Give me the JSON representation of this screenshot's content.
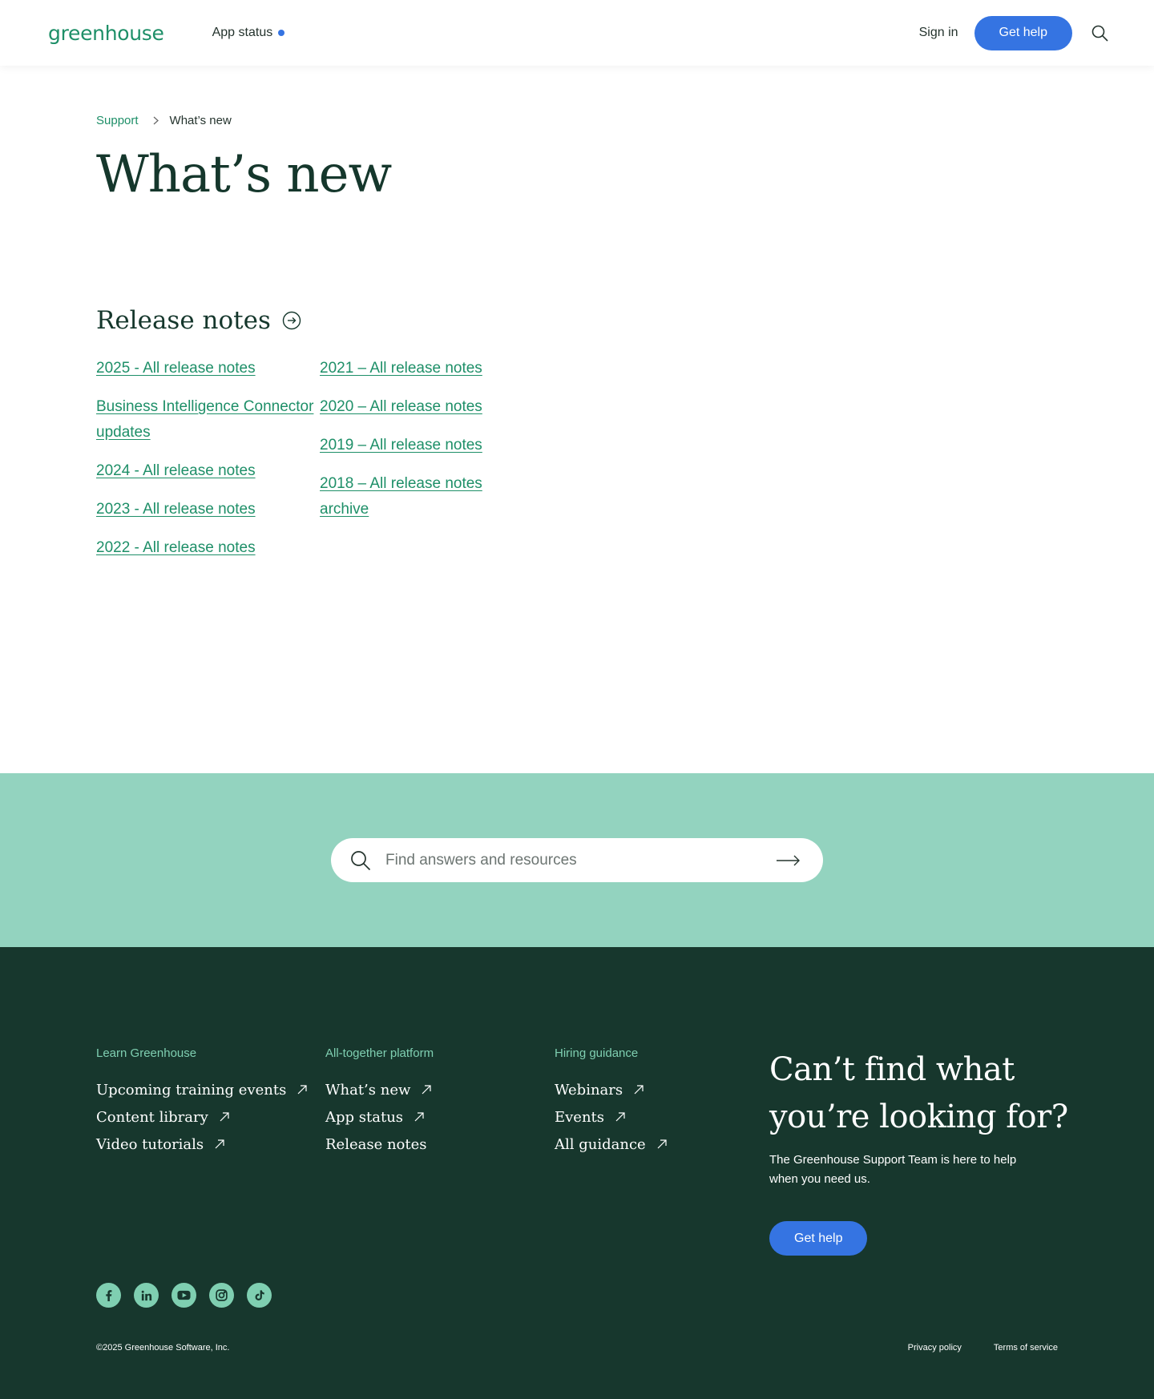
{
  "header": {
    "logo": "greenhouse",
    "app_status": "App status",
    "sign_in": "Sign in",
    "get_help": "Get help"
  },
  "breadcrumb": {
    "parent": "Support",
    "current": "What’s new"
  },
  "page_title": "What’s new",
  "release_notes": {
    "heading": "Release notes",
    "col1": [
      "2025 - All release notes",
      "Business Intelligence Connector updates",
      "2024 - All release notes",
      "2023 - All release notes",
      "2022 - All release notes"
    ],
    "col2": [
      "2021 – All release notes",
      "2020 – All release notes",
      "2019 – All release notes",
      "2018 – All release notes archive"
    ]
  },
  "search": {
    "placeholder": "Find answers and resources"
  },
  "footer": {
    "columns": [
      {
        "heading": "Learn Greenhouse",
        "items": [
          "Upcoming training events",
          "Content library",
          "Video tutorials"
        ]
      },
      {
        "heading": "All-together platform",
        "items": [
          "What’s new",
          "App status",
          "Release notes"
        ]
      },
      {
        "heading": "Hiring guidance",
        "items": [
          "Webinars",
          "Events",
          "All guidance"
        ]
      }
    ],
    "cta": {
      "title": "Can’t find what you’re looking for?",
      "text": "The Greenhouse Support Team is here to help when you need us.",
      "button": "Get help"
    },
    "socials": [
      "facebook-icon",
      "linkedin-icon",
      "youtube-icon",
      "instagram-icon",
      "tiktok-icon"
    ],
    "copyright": "©2025 Greenhouse Software, Inc.",
    "privacy": "Privacy policy",
    "terms": "Terms of service"
  },
  "colors": {
    "brand_green": "#1e8f68",
    "accent_blue": "#3574e2",
    "band_green": "#93d3bf",
    "footer_bg": "#17372d"
  }
}
